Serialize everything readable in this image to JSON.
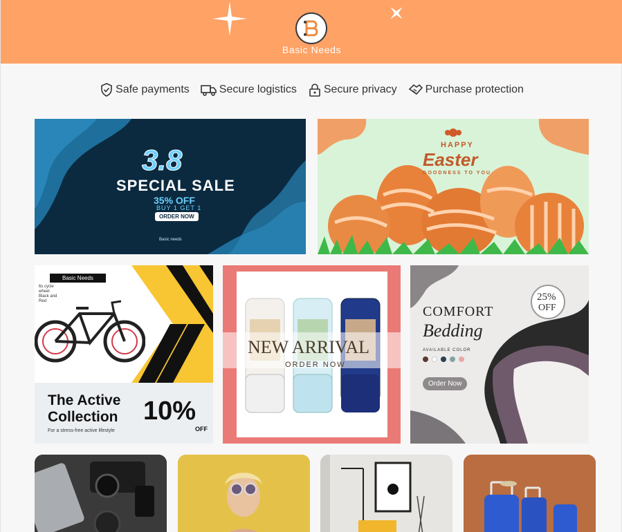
{
  "header": {
    "brand": "Basic Needs",
    "logo_letter": "B",
    "background": "#ffa266",
    "icons": [
      "sparkle-icon",
      "logo-b-icon"
    ]
  },
  "trust_bar": [
    {
      "label": "Safe payments",
      "icon": "shield-check-icon"
    },
    {
      "label": "Secure logistics",
      "icon": "truck-icon"
    },
    {
      "label": "Secure privacy",
      "icon": "lock-icon"
    },
    {
      "label": "Purchase protection",
      "icon": "handshake-icon"
    }
  ],
  "banners": {
    "sale": {
      "headline": "3.8",
      "title": "SPECIAL SALE",
      "discount": "35% OFF",
      "offer": "BUY 1 GET 1",
      "cta": "ORDER NOW",
      "footer": "Basic needs"
    },
    "easter": {
      "kicker": "HAPPY",
      "title": "Easter",
      "subtitle": "GOODNESS TO YOU"
    },
    "bike": {
      "tag": "Basic Needs",
      "spec": "6s cycle wheel Black and Red",
      "title_line1": "The Active",
      "title_line2": "Collection",
      "percent": "10%",
      "off": "OFF",
      "tagline": "For a stress-free active lifestyle"
    },
    "arrival": {
      "title": "NEW ARRIVAL",
      "cta": "ORDER NOW"
    },
    "bedding": {
      "title1": "COMFORT",
      "title2": "Bedding",
      "badge_pct": "25%",
      "badge_off": "OFF",
      "available": "AVAILABLE COLOR",
      "swatches": [
        "#5a3a2e",
        "#ffffff",
        "#2c3e50",
        "#7fa7a0",
        "#e8a8a8"
      ],
      "cta": "Order Now"
    }
  },
  "tiles": [
    {
      "subject": "camera-flatlay"
    },
    {
      "subject": "fashion-model"
    },
    {
      "subject": "home-interior"
    },
    {
      "subject": "luggage"
    }
  ]
}
